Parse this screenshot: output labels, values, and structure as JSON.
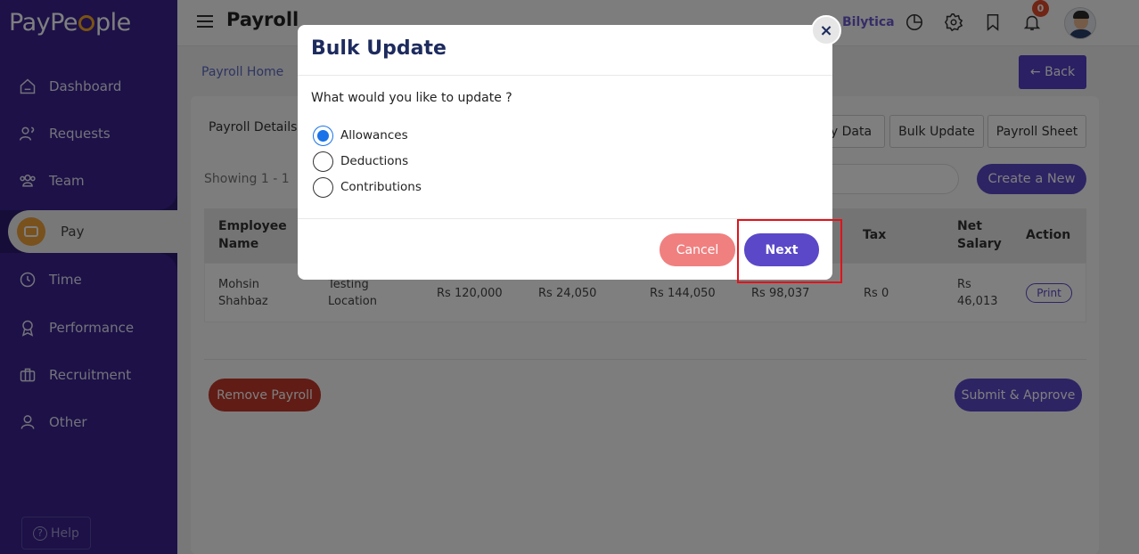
{
  "sidebar": {
    "logo": "PayPe ple",
    "items": [
      {
        "label": "Dashboard",
        "icon": "dashboard-icon"
      },
      {
        "label": "Requests",
        "icon": "requests-icon"
      },
      {
        "label": "Team",
        "icon": "team-icon"
      },
      {
        "label": "Pay",
        "icon": "wallet-icon"
      },
      {
        "label": "Time",
        "icon": "clock-icon"
      },
      {
        "label": "Performance",
        "icon": "award-icon"
      },
      {
        "label": "Recruitment",
        "icon": "briefcase-icon"
      },
      {
        "label": "Other",
        "icon": "user-icon"
      }
    ],
    "help_label": "Help"
  },
  "header": {
    "title": "Payroll",
    "company": "Bilytica",
    "notification_count": "0"
  },
  "main": {
    "breadcrumb": "Payroll Home",
    "back_label": "← Back",
    "tab_label": "Payroll Details",
    "toolbar": [
      "ly Data",
      "Bulk Update",
      "Payroll Sheet"
    ],
    "showing": "Showing 1 - 1",
    "create_label": "Create a New",
    "table": {
      "headers": [
        "Employee Name",
        "Tax",
        "Net Salary",
        "Action"
      ],
      "row": {
        "employee": "Mohsin Shahbaz",
        "location": "Testing Location",
        "basic": "Rs 120,000",
        "allowance": "Rs 24,050",
        "gross": "Rs 144,050",
        "deduction": "Rs 98,037",
        "tax": "Rs 0",
        "net": "Rs 46,013",
        "action": "Print"
      }
    },
    "remove_label": "Remove Payroll",
    "submit_label": "Submit & Approve"
  },
  "modal": {
    "title": "Bulk Update",
    "question": "What would you like to update ?",
    "options": [
      {
        "label": "Allowances",
        "checked": true
      },
      {
        "label": "Deductions",
        "checked": false
      },
      {
        "label": "Contributions",
        "checked": false
      }
    ],
    "cancel_label": "Cancel",
    "next_label": "Next",
    "close_label": "×"
  },
  "colors": {
    "sidebar": "#3a2390",
    "accent": "#5a48c8",
    "cancel": "#f08080",
    "remove": "#c0392b",
    "highlight": "#e0131a"
  }
}
